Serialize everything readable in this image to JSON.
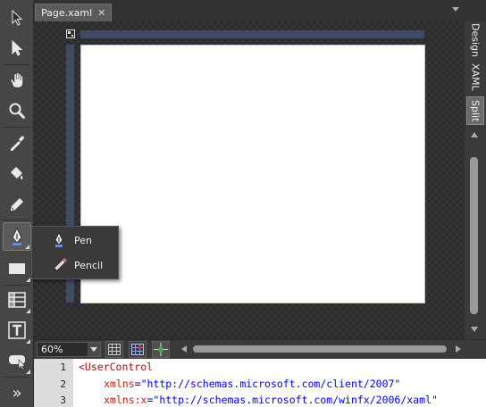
{
  "document_tab": {
    "title": "Page.xaml",
    "close_glyph": "✕"
  },
  "view_tabs": [
    {
      "label": "Design",
      "selected": false
    },
    {
      "label": "XAML",
      "selected": false
    },
    {
      "label": "Split",
      "selected": true
    }
  ],
  "toolbar": {
    "tools": [
      "selection-icon",
      "direct-selection-icon",
      "pan-icon",
      "zoom-icon",
      "eyedropper-icon",
      "paint-bucket-icon",
      "brush-transform-icon",
      "pen-icon",
      "rectangle-icon",
      "grid-icon",
      "text-icon",
      "control-icon",
      "more-icon"
    ],
    "selected_tool": "pen-icon",
    "more_glyph": "»"
  },
  "flyout": {
    "items": [
      {
        "label": "Pen",
        "icon": "pen-icon"
      },
      {
        "label": "Pencil",
        "icon": "pencil-icon"
      }
    ]
  },
  "statusbar": {
    "zoom_value": "60%"
  },
  "code": {
    "lines": [
      {
        "num": "1",
        "text": "<UserControl"
      },
      {
        "num": "2",
        "attr": "xmlns",
        "value": "\"http://schemas.microsoft.com/client/2007\""
      },
      {
        "num": "3",
        "attr": "xmlns:x",
        "value": "\"http://schemas.microsoft.com/winfx/2006/xaml\""
      }
    ]
  },
  "colors": {
    "artboard": "#ffffff",
    "ruler": "#3f4b63",
    "chrome": "#3c3c3c"
  }
}
